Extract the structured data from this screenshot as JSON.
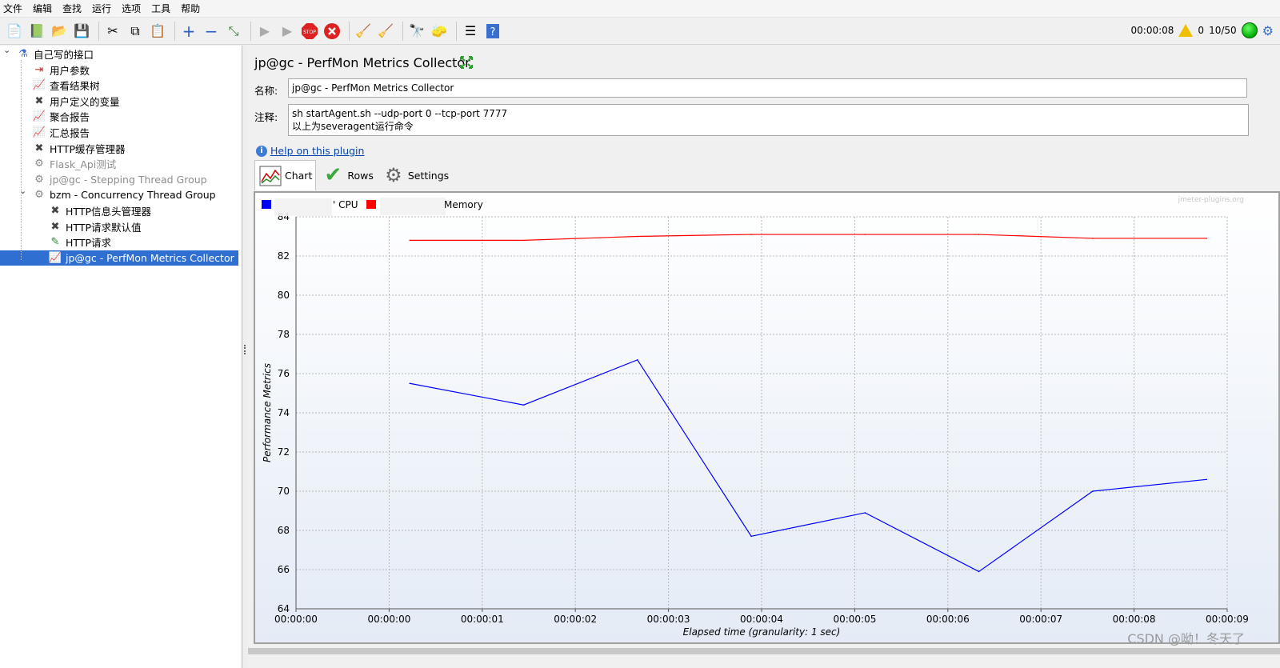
{
  "menu": [
    "文件",
    "编辑",
    "查找",
    "运行",
    "选项",
    "工具",
    "帮助"
  ],
  "toolbar_icons": [
    "new-icon",
    "templates-icon",
    "open-icon",
    "save-icon",
    "cut-icon",
    "copy-icon",
    "paste-icon",
    "expand-icon",
    "collapse-icon",
    "toggle-icon",
    "start-icon",
    "start-no-pause-icon",
    "stop-icon",
    "shutdown-icon",
    "clear-icon",
    "clear-all-icon",
    "search-icon",
    "reset-search-icon",
    "function-helper-icon",
    "help-icon"
  ],
  "status": {
    "elapsed": "00:00:08",
    "errors": "0",
    "threads": "10/50"
  },
  "tree": [
    {
      "label": "自己写的接口",
      "icon": "flask-icon",
      "level": 0,
      "state": "normal",
      "toggle": "⌄"
    },
    {
      "label": "用户参数",
      "icon": "preprocessor-icon",
      "level": 1,
      "state": "normal"
    },
    {
      "label": "查看结果树",
      "icon": "listener-icon",
      "level": 1,
      "state": "normal"
    },
    {
      "label": "用户定义的变量",
      "icon": "config-wrench-icon",
      "level": 1,
      "state": "normal"
    },
    {
      "label": "聚合报告",
      "icon": "listener-icon",
      "level": 1,
      "state": "normal"
    },
    {
      "label": "汇总报告",
      "icon": "listener-icon",
      "level": 1,
      "state": "normal"
    },
    {
      "label": "HTTP缓存管理器",
      "icon": "config-wrench-icon",
      "level": 1,
      "state": "normal"
    },
    {
      "label": "Flask_Api测试",
      "icon": "thread-group-icon",
      "level": 1,
      "state": "disabled"
    },
    {
      "label": "jp@gc - Stepping Thread Group",
      "icon": "thread-group-icon",
      "level": 1,
      "state": "disabled"
    },
    {
      "label": "bzm - Concurrency Thread Group",
      "icon": "thread-group-icon",
      "level": 1,
      "state": "normal",
      "toggle": "⌄"
    },
    {
      "label": "HTTP信息头管理器",
      "icon": "config-wrench-icon",
      "level": 2,
      "state": "normal"
    },
    {
      "label": "HTTP请求默认值",
      "icon": "config-wrench-icon",
      "level": 2,
      "state": "normal"
    },
    {
      "label": "HTTP请求",
      "icon": "sampler-pipette-icon",
      "level": 2,
      "state": "normal"
    },
    {
      "label": "jp@gc - PerfMon Metrics Collector",
      "icon": "listener-icon",
      "level": 2,
      "state": "selected"
    }
  ],
  "panel": {
    "title": "jp@gc - PerfMon Metrics Collector",
    "name_label": "名称:",
    "name_value": "jp@gc - PerfMon Metrics Collector",
    "comment_label": "注释:",
    "comment_line1": "sh startAgent.sh --udp-port 0 --tcp-port 7777",
    "comment_line2": "以上为severagent运行命令",
    "help_link": "Help on this plugin",
    "tabs": [
      "Chart",
      "Rows",
      "Settings"
    ]
  },
  "chart_data": {
    "type": "line",
    "watermark": "jmeter-plugins.org",
    "xlabel": "Elapsed time (granularity: 1 sec)",
    "ylabel": "Performance Metrics",
    "ylim": [
      64,
      84
    ],
    "yticks": [
      64,
      66,
      68,
      70,
      72,
      74,
      76,
      78,
      80,
      82,
      84
    ],
    "xlim_seconds": [
      0,
      9
    ],
    "xtick_labels": [
      "00:00:00",
      "00:00:00",
      "00:00:01",
      "00:00:02",
      "00:00:03",
      "00:00:04",
      "00:00:05",
      "00:00:06",
      "00:00:07",
      "00:00:08",
      "00:00:09"
    ],
    "legend_placement": "top-left",
    "series": [
      {
        "name": "CPU",
        "legend_text": "' CPU",
        "color": "#0000ff",
        "x": [
          1.1,
          2.2,
          3.3,
          4.4,
          5.5,
          6.6,
          7.7,
          8.8
        ],
        "y": [
          75.5,
          74.4,
          76.7,
          67.7,
          68.9,
          65.9,
          70.0,
          70.6
        ]
      },
      {
        "name": "Memory",
        "legend_text": "Memory",
        "color": "#ff0000",
        "x": [
          1.1,
          2.2,
          3.3,
          4.4,
          5.5,
          6.6,
          7.7,
          8.8
        ],
        "y": [
          82.8,
          82.8,
          83.0,
          83.1,
          83.1,
          83.1,
          82.9,
          82.9
        ]
      }
    ]
  },
  "watermark_text": "CSDN @呦！冬天了"
}
